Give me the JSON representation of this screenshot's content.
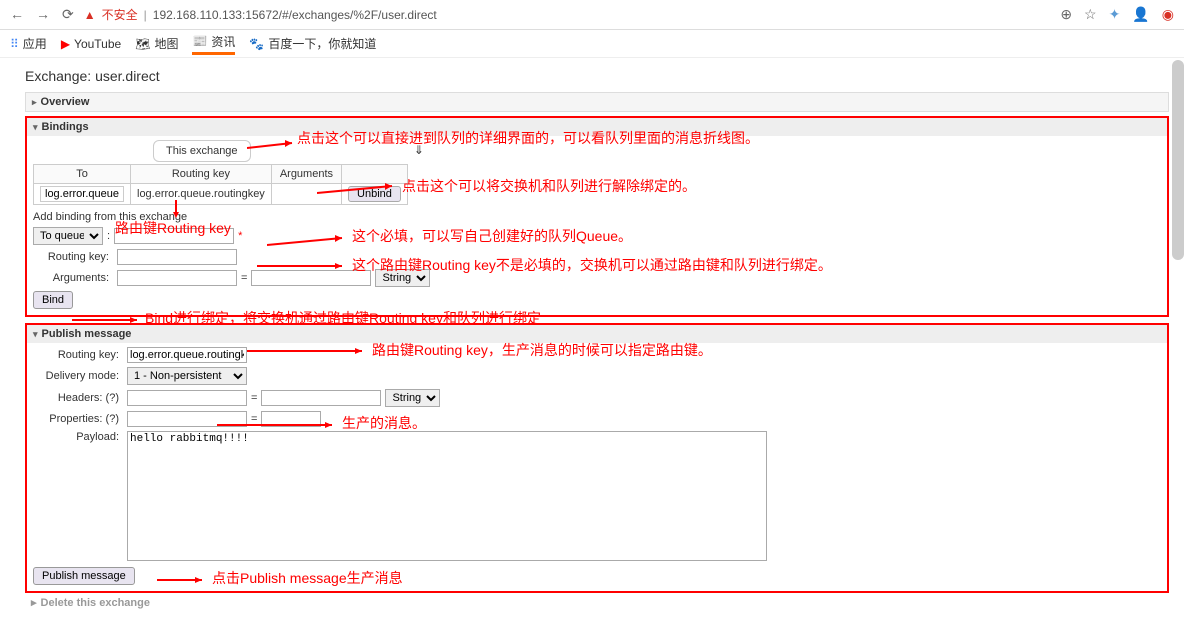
{
  "browser": {
    "insecure": "不安全",
    "url": "192.168.110.133:15672/#/exchanges/%2F/user.direct"
  },
  "bookmarks": {
    "apps": "应用",
    "youtube": "YouTube",
    "maps": "地图",
    "news": "资讯",
    "baidu": "百度一下，你就知道"
  },
  "page": {
    "title_label": "Exchange: ",
    "title_value": "user.direct"
  },
  "sections": {
    "overview": "Overview",
    "bindings": "Bindings",
    "publish": "Publish message",
    "delete": "Delete this exchange"
  },
  "bindings": {
    "this_exchange": "This exchange",
    "th_to": "To",
    "th_routing": "Routing key",
    "th_args": "Arguments",
    "queue_name": "log.error.queue",
    "routing_key": "log.error.queue.routingkey",
    "unbind": "Unbind",
    "add_binding": "Add binding from this exchange",
    "to_queue_opt": "To queue",
    "routing_label": "Routing key:",
    "args_label": "Arguments:",
    "type_opt": "String",
    "bind_btn": "Bind"
  },
  "publish": {
    "routing_label": "Routing key:",
    "routing_value": "log.error.queue.routingke",
    "delivery_label": "Delivery mode:",
    "delivery_opt": "1 - Non-persistent",
    "headers_label": "Headers:",
    "props_label": "Properties:",
    "payload_label": "Payload:",
    "payload_value": "hello rabbitmq!!!!",
    "type_opt": "String",
    "publish_btn": "Publish message",
    "help": "(?)"
  },
  "annotations": {
    "a1": "点击这个可以直接进到队列的详细界面的，可以看队列里面的消息折线图。",
    "a2": "点击这个可以将交换机和队列进行解除绑定的。",
    "a3": "路由键Routing key",
    "a4": "这个必填，可以写自己创建好的队列Queue。",
    "a5": "这个路由键Routing key不是必填的，交换机可以通过路由键和队列进行绑定。",
    "a6": "Bind进行绑定，将交换机通过路由键Routing key和队列进行绑定",
    "a7": "路由键Routing key，生产消息的时候可以指定路由键。",
    "a8": "生产的消息。",
    "a9": "点击Publish message生产消息"
  }
}
